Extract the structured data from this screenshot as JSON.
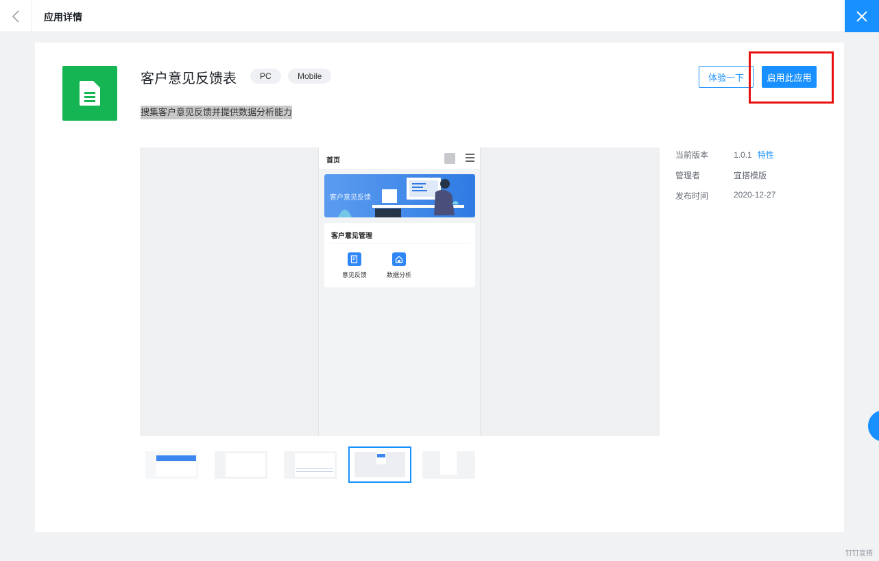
{
  "header": {
    "title": "应用详情"
  },
  "app": {
    "name": "客户意见反馈表",
    "tags": [
      "PC",
      "Mobile"
    ],
    "description": "搜集客户意见反馈并提供数据分析能力",
    "try_label": "体验一下",
    "enable_label": "启用此应用"
  },
  "preview": {
    "phone_title": "首页",
    "banner_text": "客户意见反馈",
    "section_title": "客户意见管理",
    "features": [
      "意见反馈",
      "数据分析"
    ]
  },
  "thumbnails": {
    "count": 5,
    "selected_index": 3
  },
  "info": {
    "version_label": "当前版本",
    "version_value": "1.0.1",
    "features_link": "特性",
    "manager_label": "管理者",
    "manager_value": "宜搭模版",
    "release_label": "发布时间",
    "release_value": "2020-12-27"
  },
  "watermark": "钉钉宜搭",
  "colors": {
    "accent": "#1890ff",
    "app_icon": "#15b554",
    "highlight": "#e8100f"
  }
}
